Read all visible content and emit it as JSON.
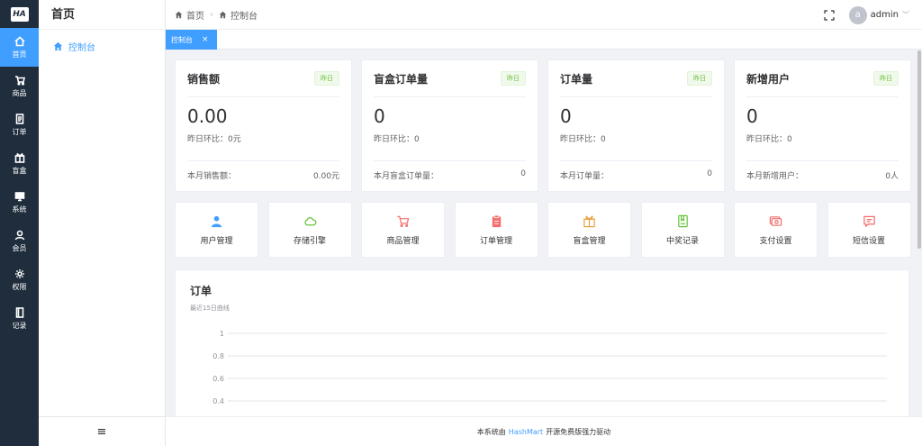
{
  "logo": "HA",
  "rail": [
    {
      "label": "首页",
      "icon": "home-icon"
    },
    {
      "label": "商品",
      "icon": "cart-icon"
    },
    {
      "label": "订单",
      "icon": "document-icon"
    },
    {
      "label": "盲盒",
      "icon": "box-icon"
    },
    {
      "label": "系统",
      "icon": "monitor-icon"
    },
    {
      "label": "会员",
      "icon": "user-icon"
    },
    {
      "label": "权限",
      "icon": "gear-icon"
    },
    {
      "label": "记录",
      "icon": "book-icon"
    }
  ],
  "submenu": {
    "title": "首页",
    "items": [
      {
        "label": "控制台",
        "icon": "home-icon"
      }
    ],
    "collapse_icon": "≡"
  },
  "header": {
    "breadcrumb": [
      "首页",
      "控制台"
    ],
    "avatar_letter": "a",
    "user": "admin"
  },
  "tabs": [
    {
      "label": "控制台",
      "close": "×"
    }
  ],
  "stats": [
    {
      "title": "销售额",
      "badge": "昨日",
      "value": "0.00",
      "compare": "昨日环比：0元",
      "foot_label": "本月销售额：",
      "foot_value": "0.00元"
    },
    {
      "title": "盲盒订单量",
      "badge": "昨日",
      "value": "0",
      "compare": "昨日环比：0",
      "foot_label": "本月盲盒订单量：",
      "foot_value": "0"
    },
    {
      "title": "订单量",
      "badge": "昨日",
      "value": "0",
      "compare": "昨日环比：0",
      "foot_label": "本月订单量：",
      "foot_value": "0"
    },
    {
      "title": "新增用户",
      "badge": "昨日",
      "value": "0",
      "compare": "昨日环比：0",
      "foot_label": "本月新增用户：",
      "foot_value": "0人"
    }
  ],
  "shortcuts": [
    {
      "label": "用户管理",
      "icon": "user-icon",
      "color": "#409eff"
    },
    {
      "label": "存储引擎",
      "icon": "cloud-icon",
      "color": "#67c23a"
    },
    {
      "label": "商品管理",
      "icon": "cart-icon",
      "color": "#f56c6c"
    },
    {
      "label": "订单管理",
      "icon": "clipboard-icon",
      "color": "#f56c6c"
    },
    {
      "label": "盲盒管理",
      "icon": "box-icon",
      "color": "#e6a23c"
    },
    {
      "label": "中奖记录",
      "icon": "bookmark-icon",
      "color": "#67c23a"
    },
    {
      "label": "支付设置",
      "icon": "payment-icon",
      "color": "#f56c6c"
    },
    {
      "label": "短信设置",
      "icon": "message-icon",
      "color": "#f56c6c"
    }
  ],
  "chart": {
    "title": "订单",
    "subtitle": "最近15日曲线"
  },
  "chart_data": {
    "type": "line",
    "title": "订单",
    "subtitle": "最近15日曲线",
    "ylim": [
      0,
      1
    ],
    "y_ticks": [
      "1",
      "0.8",
      "0.6",
      "0.4"
    ],
    "grid": true,
    "series": []
  },
  "footer": {
    "prefix": "本系统由",
    "brand": "HashMart",
    "suffix": "开源免费版强力驱动"
  },
  "colors": {
    "accent": "#409eff",
    "rail": "#1f2d3d",
    "badge_green": "#67c23a"
  }
}
